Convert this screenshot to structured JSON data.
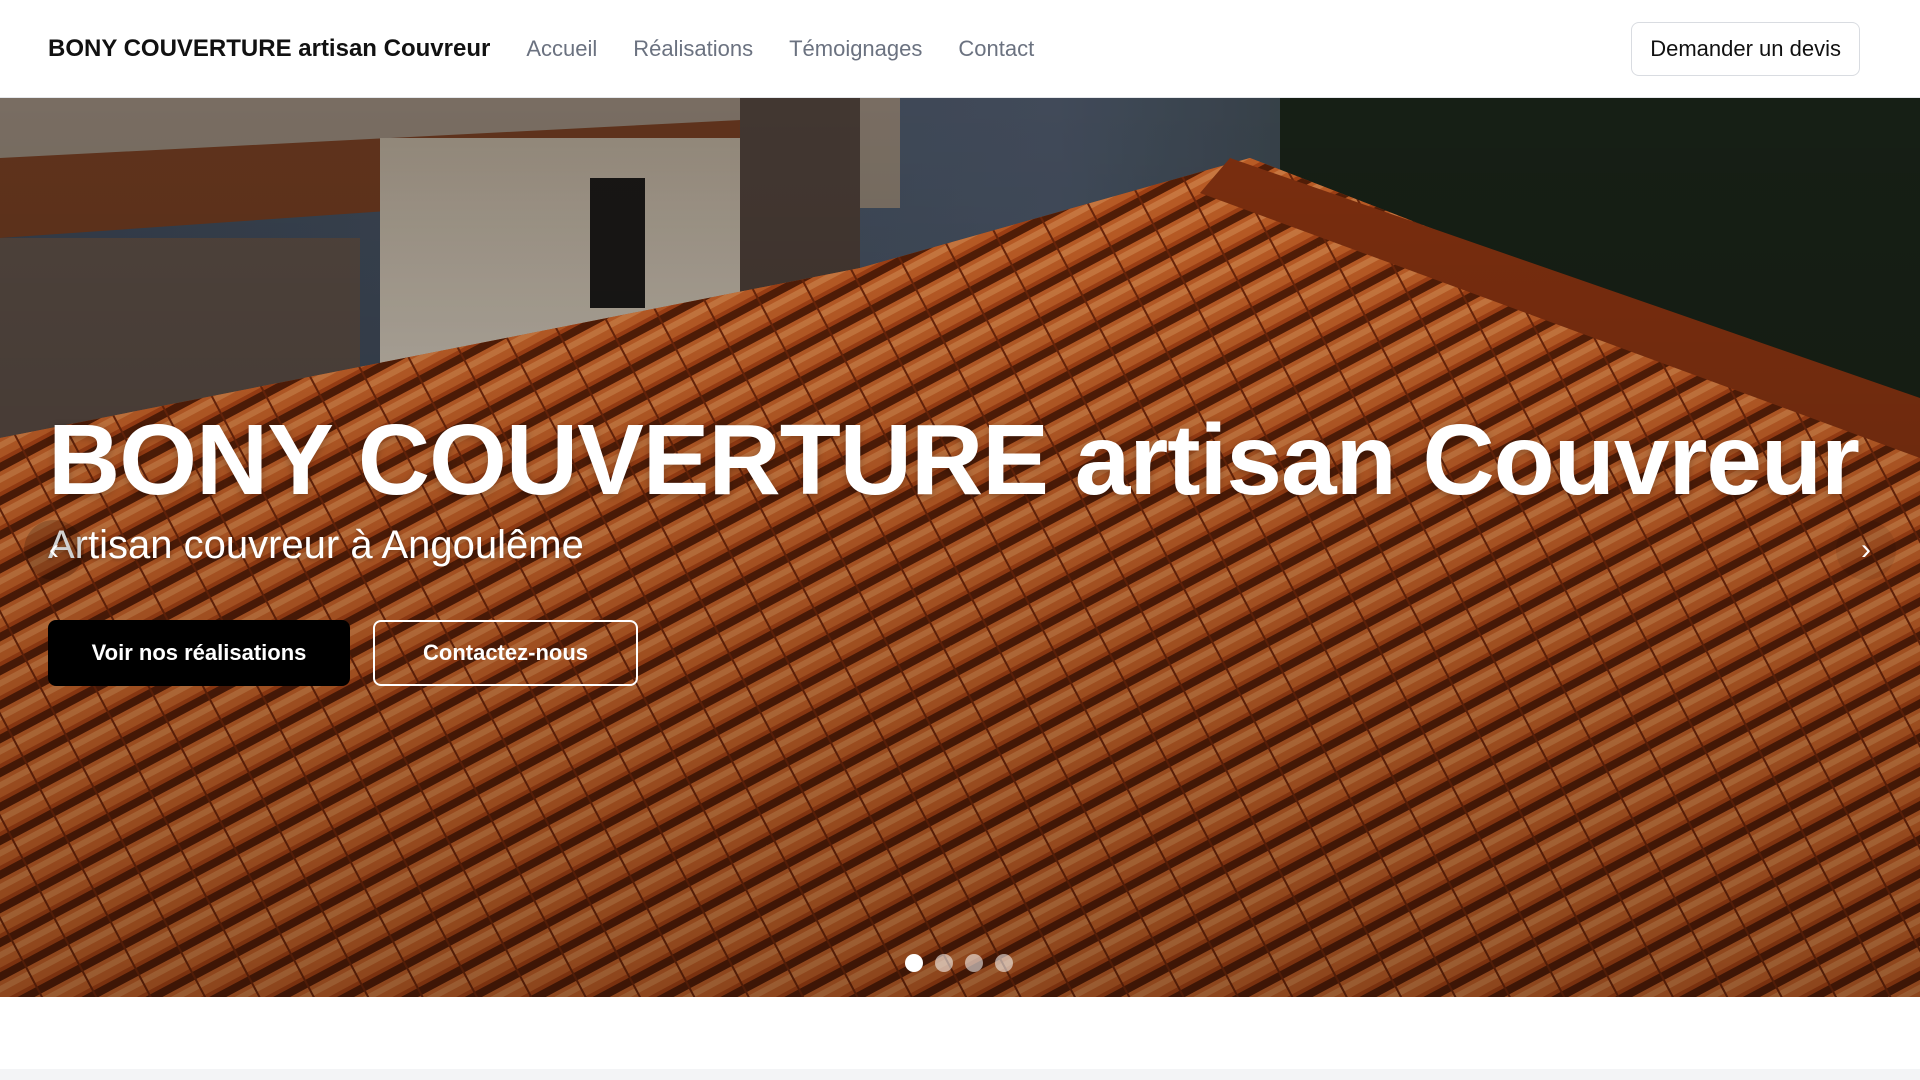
{
  "header": {
    "brand": "BONY COUVERTURE artisan Couvreur",
    "nav": [
      "Accueil",
      "Réalisations",
      "Témoignages",
      "Contact"
    ],
    "cta_label": "Demander un devis"
  },
  "hero": {
    "title": "BONY COUVERTURE artisan Couvreur",
    "subtitle": "Artisan couvreur à Angoulême",
    "primary_button": "Voir nos réalisations",
    "secondary_button": "Contactez-nous",
    "prev_icon": "chevron-left-icon",
    "next_icon": "chevron-right-icon",
    "slide_count": 4,
    "active_slide": 1
  },
  "colors": {
    "primary_button_bg": "#000000",
    "nav_text": "#6b7280",
    "tile_orange": "#c6531f",
    "tile_dark": "#5a1f0a"
  }
}
